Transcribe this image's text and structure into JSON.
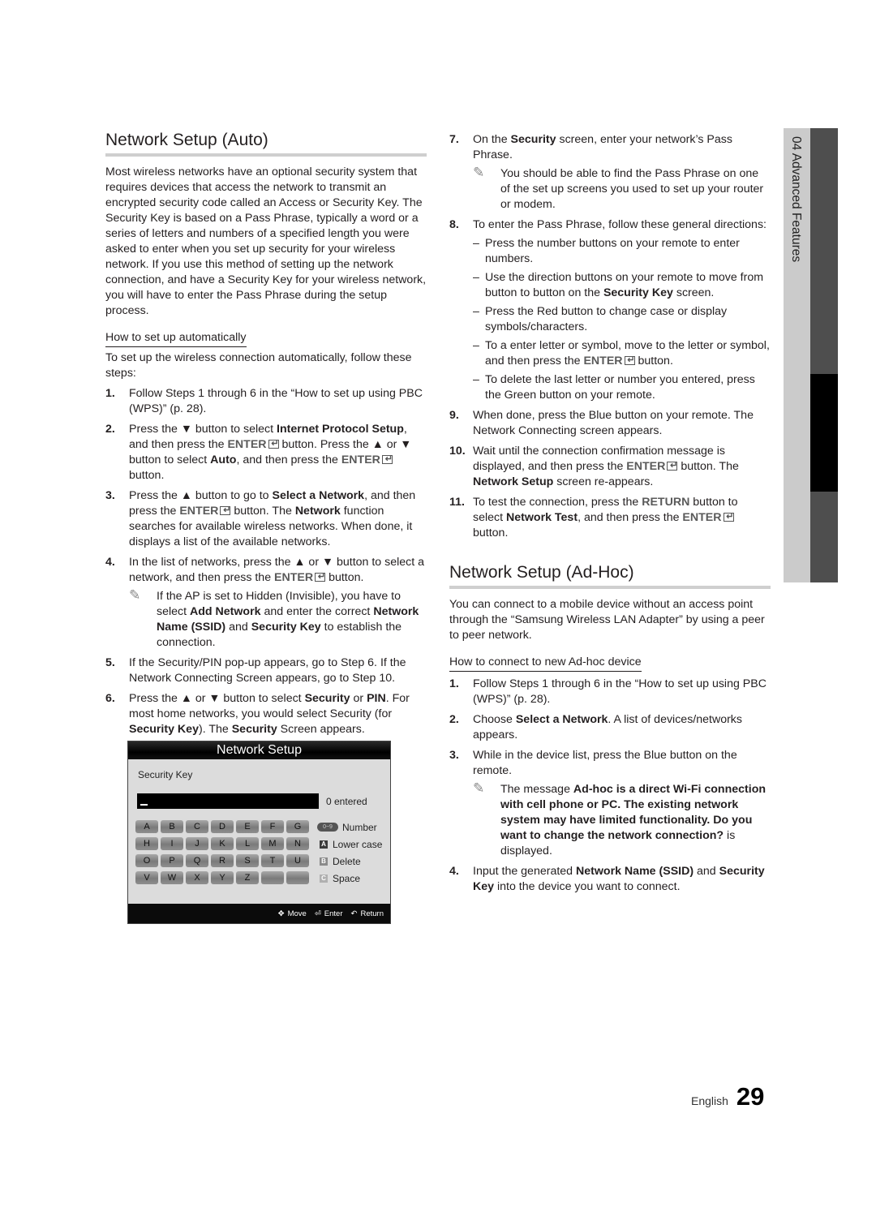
{
  "left": {
    "title": "Network Setup (Auto)",
    "intro": "Most wireless networks have an optional security system that requires devices that access the network to transmit an encrypted security code called an Access or Security Key. The Security Key is based on a Pass Phrase, typically a word or a series of letters and numbers of a specified length you were asked to enter when you set up security for your wireless network.  If you use this method of setting up the network connection, and have a Security Key for your wireless network, you will have to enter the Pass Phrase during the setup process.",
    "subheading": "How to set up automatically",
    "lead": "To set up the wireless connection automatically, follow these steps:",
    "steps": [
      {
        "num": "1.",
        "text": "Follow Steps 1 through 6 in the “How to set up using PBC (WPS)” (p. 28)."
      },
      {
        "num": "2.",
        "parts": [
          "Press the ▼ button to select ",
          "Internet Protocol Setup",
          ", and then press the ",
          "ENTER",
          " button. Press the ▲ or ▼ button to select ",
          "Auto",
          ", and then press the ",
          "ENTER",
          " button."
        ]
      },
      {
        "num": "3.",
        "parts": [
          "Press the ▲ button to go to ",
          "Select a Network",
          ", and then press the ",
          "ENTER",
          " button. The ",
          "Network",
          " function searches for available wireless networks. When done, it displays a list of the available networks."
        ]
      },
      {
        "num": "4.",
        "parts": [
          "In the list of networks, press the ▲ or ▼ button to select a network, and then press the ",
          "ENTER",
          " button."
        ],
        "note": [
          "If the AP is set to Hidden (Invisible), you have to select ",
          "Add Network",
          " and enter the correct ",
          "Network Name (SSID)",
          " and ",
          "Security Key",
          " to establish the connection."
        ]
      },
      {
        "num": "5.",
        "text": "If the Security/PIN pop-up appears, go to Step 6. If the Network Connecting Screen appears, go to Step 10."
      },
      {
        "num": "6.",
        "parts": [
          "Press the ▲ or ▼ button to select ",
          "Security",
          " or ",
          "PIN",
          ". For most home networks, you would select Security (for ",
          "Security Key",
          "). The ",
          "Security",
          " Screen appears."
        ]
      }
    ]
  },
  "tv_screen": {
    "title": "Network Setup",
    "field_label": "Security Key",
    "entered_count": "0 entered",
    "keys": [
      "A",
      "B",
      "C",
      "D",
      "E",
      "F",
      "G",
      "H",
      "I",
      "J",
      "K",
      "L",
      "M",
      "N",
      "O",
      "P",
      "Q",
      "R",
      "S",
      "T",
      "U",
      "V",
      "W",
      "X",
      "Y",
      "Z",
      "",
      ""
    ],
    "legend": [
      {
        "badge": "0~9",
        "label": "Number",
        "color": "#555555"
      },
      {
        "badge": "A",
        "label": "Lower case",
        "color": "#3a3a3a"
      },
      {
        "badge": "B",
        "label": "Delete",
        "color": "#8a8a8a"
      },
      {
        "badge": "C",
        "label": "Space",
        "color": "#b0b0b0"
      }
    ],
    "footer": {
      "move": "Move",
      "enter": "Enter",
      "return": "Return"
    }
  },
  "right": {
    "steps": [
      {
        "num": "7.",
        "parts": [
          "On the ",
          "Security",
          " screen, enter your network’s Pass Phrase."
        ],
        "note": "You should be able to find the Pass Phrase on one of the set up screens you used to set up your router or modem."
      },
      {
        "num": "8.",
        "text": "To enter the Pass Phrase, follow these general directions:",
        "bullets": [
          "Press the number buttons on your remote to enter numbers.",
          "Use the direction buttons on your remote to move from button to button on the |Security Key| screen.",
          "Press the Red button to change case or display symbols/characters.",
          "To a enter letter or symbol, move to the letter or symbol, and then press the ENTER button.",
          "To delete the last letter or number you entered, press the Green button on your remote."
        ]
      },
      {
        "num": "9.",
        "text": "When done, press the Blue button on your remote. The Network Connecting screen appears."
      },
      {
        "num": "10.",
        "parts": [
          "Wait until the connection confirmation message is displayed, and then press the ",
          "ENTER",
          " button. The ",
          "Network Setup",
          " screen re-appears."
        ]
      },
      {
        "num": "11.",
        "parts": [
          "To test the connection, press the ",
          "RETURN",
          " button to select ",
          "Network Test",
          ", and then press the ",
          "ENTER",
          " button."
        ]
      }
    ],
    "adhoc": {
      "title": "Network Setup (Ad-Hoc)",
      "intro": "You can connect to a mobile device without an access point through the “Samsung Wireless LAN Adapter” by using a peer to peer network.",
      "subheading": "How to connect to new Ad-hoc device",
      "steps": [
        {
          "num": "1.",
          "text": "Follow Steps 1 through 6 in the “How to set up using PBC (WPS)” (p. 28)."
        },
        {
          "num": "2.",
          "parts": [
            "Choose ",
            "Select a Network",
            ". A list of devices/networks appears."
          ]
        },
        {
          "num": "3.",
          "text": "While in the device list, press the Blue button on the remote.",
          "note": [
            "The message ",
            "Ad-hoc is a direct Wi-Fi connection with cell phone or PC. The existing network system may have limited functionality. Do you want to change the network connection?",
            " is displayed."
          ]
        },
        {
          "num": "4.",
          "parts": [
            "Input the generated ",
            "Network Name (SSID)",
            " and ",
            "Security Key",
            " into the device you want to connect."
          ]
        }
      ]
    }
  },
  "side_tab": {
    "label": "04  Advanced Features"
  },
  "footer": {
    "language": "English",
    "page_number": "29"
  }
}
